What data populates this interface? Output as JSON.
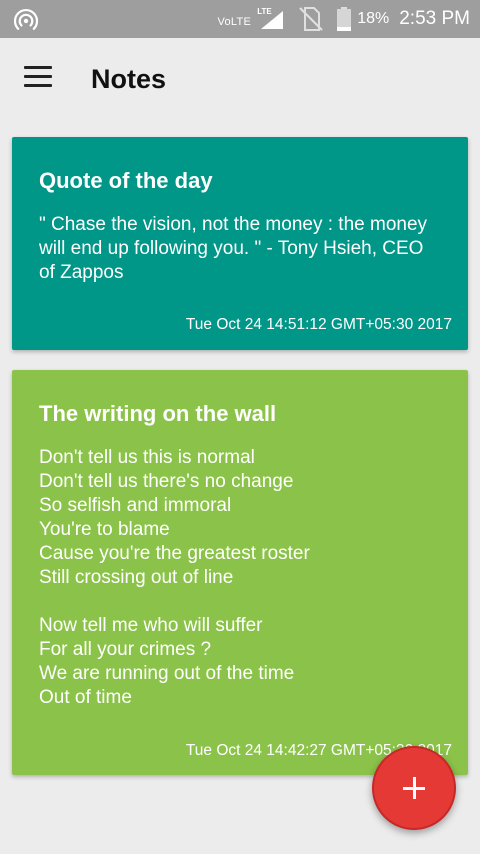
{
  "status_bar": {
    "volte_label": "VoLTE",
    "lte_label": "LTE",
    "battery_percent": "18%",
    "time": "2:53 PM",
    "icons": [
      "hotspot-icon",
      "signal-icon",
      "no-sim-icon",
      "battery-icon"
    ]
  },
  "app_bar": {
    "title": "Notes",
    "menu_icon": "hamburger-menu-icon"
  },
  "notes": [
    {
      "title": "Quote of the day",
      "body": "\" Chase the vision, not the money : the money will end up following you. \" - Tony Hsieh, CEO of Zappos",
      "date": "Tue Oct 24 14:51:12 GMT+05:30 2017",
      "color": "#009688"
    },
    {
      "title": "The writing on the wall",
      "body": "Don't tell us this is normal\nDon't tell us there's no change\nSo selfish and immoral\nYou're to blame\nCause you're the greatest roster\nStill crossing out of line\n\nNow tell me who will suffer\nFor all your crimes ?\nWe are running out of the time\nOut of time",
      "date": "Tue Oct 24 14:42:27 GMT+05:30 2017",
      "color": "#8bc34a"
    }
  ],
  "fab": {
    "icon": "add-icon",
    "color": "#e53935"
  }
}
